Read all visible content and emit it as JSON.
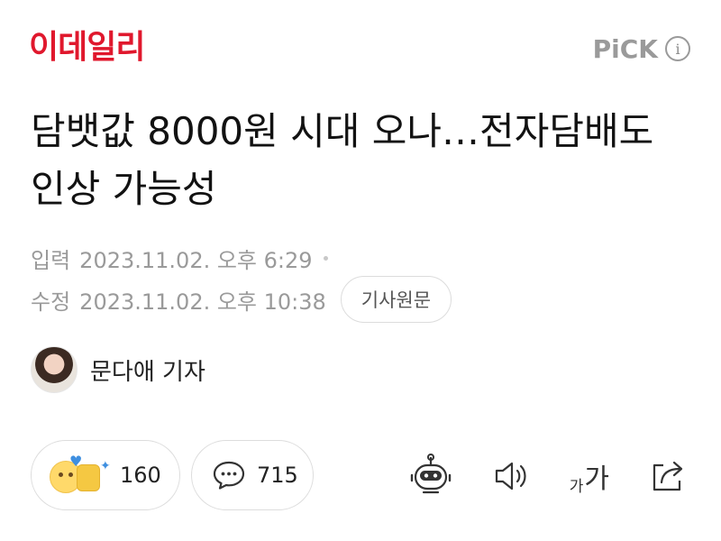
{
  "header": {
    "logo_text": "이데일리",
    "pick_label": "PiCK",
    "info_icon": "info-icon"
  },
  "article": {
    "headline": "담뱃값 8000원 시대 오나…전자담배도 인상 가능성",
    "published_label": "입력",
    "published_date": "2023.11.02. 오후 6:29",
    "modified_label": "수정",
    "modified_date": "2023.11.02. 오후 10:38",
    "original_button": "기사원문",
    "reporter": "문다애 기자"
  },
  "reactions": {
    "likes_count": "160",
    "comments_count": "715"
  },
  "toolbar": {
    "font_small": "가",
    "font_large": "가",
    "icons": [
      "robot-summary-icon",
      "speaker-icon",
      "font-size-icon",
      "share-icon"
    ]
  },
  "colors": {
    "brand": "#e0182d",
    "muted": "#9a9a9a"
  }
}
